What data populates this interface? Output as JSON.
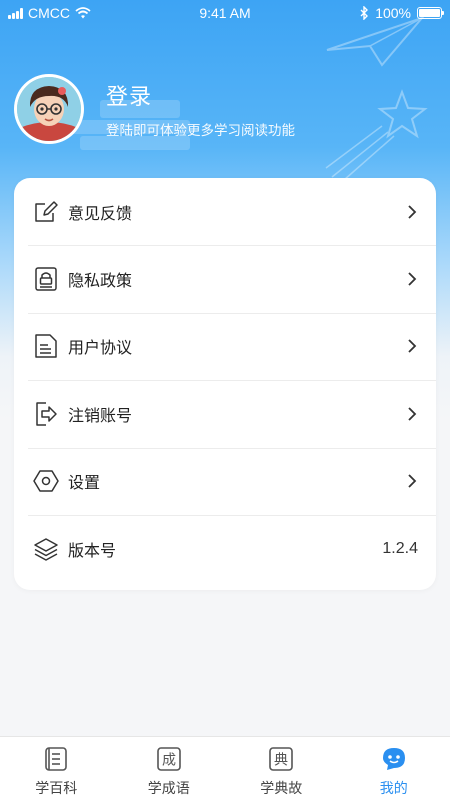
{
  "status_bar": {
    "carrier": "CMCC",
    "time": "9:41 AM",
    "battery": "100%",
    "battery_level": 1.0
  },
  "profile": {
    "title": "登录",
    "subtitle": "登陆即可体验更多学习阅读功能"
  },
  "menu": {
    "items": [
      {
        "label": "意见反馈",
        "icon": "edit-icon"
      },
      {
        "label": "隐私政策",
        "icon": "privacy-icon"
      },
      {
        "label": "用户协议",
        "icon": "document-icon"
      },
      {
        "label": "注销账号",
        "icon": "logout-icon"
      },
      {
        "label": "设置",
        "icon": "settings-hexagon-icon"
      },
      {
        "label": "版本号",
        "icon": "layers-icon",
        "value": "1.2.4"
      }
    ]
  },
  "tabbar": {
    "tabs": [
      {
        "label": "学百科",
        "icon": "encyclopedia-icon"
      },
      {
        "label": "学成语",
        "icon": "idiom-icon",
        "glyph": "成"
      },
      {
        "label": "学典故",
        "icon": "allusion-icon",
        "glyph": "典"
      },
      {
        "label": "我的",
        "icon": "profile-face-icon",
        "active": true
      }
    ]
  },
  "colors": {
    "accent": "#2a8ff0",
    "header_top": "#3da4f4",
    "background": "#f5f6f8"
  }
}
